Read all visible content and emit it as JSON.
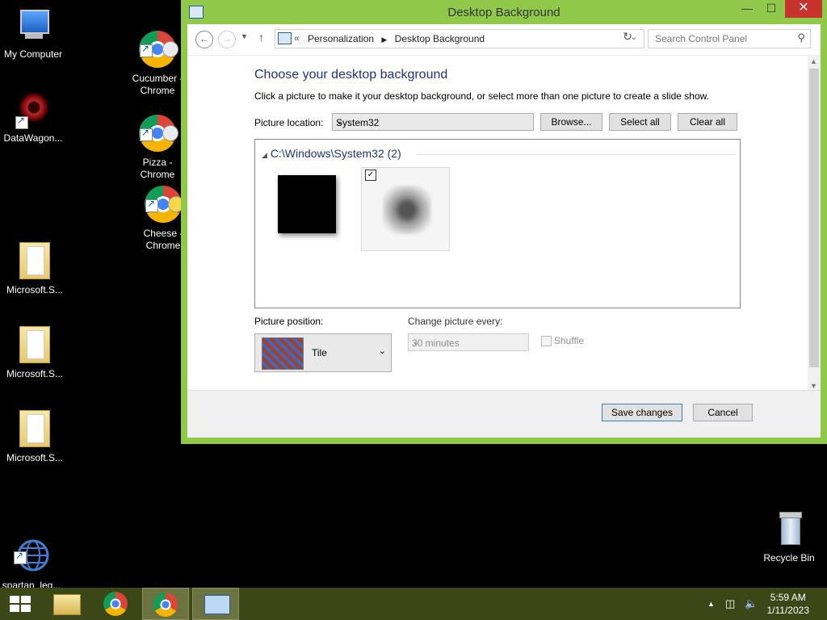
{
  "desktop": {
    "icons": [
      {
        "label": "My Computer"
      },
      {
        "label": "DataWagon..."
      },
      {
        "label": "Microsoft.S..."
      },
      {
        "label": "Microsoft.S..."
      },
      {
        "label": "Microsoft.S..."
      },
      {
        "label": "spartan_leg...\n- Shortcut"
      },
      {
        "label": "Cucumber -\nChrome"
      },
      {
        "label": "Pizza -\nChrome"
      },
      {
        "label": "Cheese -\nChrome"
      },
      {
        "label": "Recycle Bin"
      }
    ]
  },
  "window": {
    "title": "Desktop Background",
    "controls": {
      "minimize": "—",
      "maximize": "☐",
      "close": "✕"
    },
    "address": {
      "crumbs": [
        "Personalization",
        "Desktop Background"
      ],
      "prefix": "«",
      "search_placeholder": "Search Control Panel"
    },
    "heading": "Choose your desktop background",
    "subtitle": "Click a picture to make it your desktop background, or select more than one picture to create a slide show.",
    "picture_location": {
      "label": "Picture location:",
      "value": "System32",
      "browse": "Browse...",
      "select_all": "Select all",
      "clear_all": "Clear all"
    },
    "gallery": {
      "group": "C:\\Windows\\System32 (2)",
      "pictures": [
        {
          "checked": false
        },
        {
          "checked": true
        }
      ]
    },
    "picture_position": {
      "label": "Picture position:",
      "value": "Tile"
    },
    "change_picture": {
      "label": "Change picture every:",
      "value": "30 minutes"
    },
    "shuffle": {
      "label": "Shuffle",
      "checked": false
    },
    "footer": {
      "save": "Save changes",
      "cancel": "Cancel"
    }
  },
  "taskbar": {
    "time": "5:59 AM",
    "date": "1/11/2023"
  }
}
